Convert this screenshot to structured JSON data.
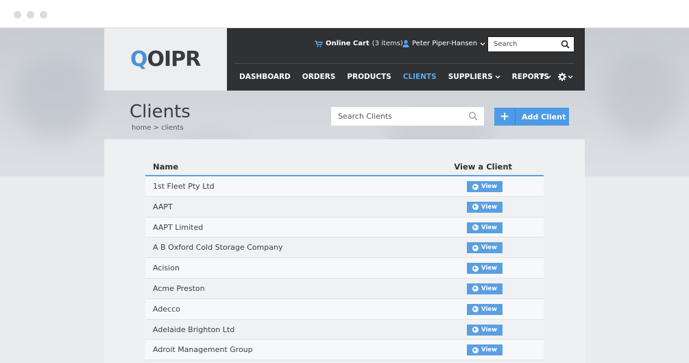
{
  "header": {
    "logo_text": "OIPR",
    "logo_q": "Q",
    "cart_label": "Online Cart",
    "cart_count": "(3 items)",
    "user_name": "Peter Piper-Hansen",
    "search_placeholder": "Search"
  },
  "nav": {
    "items": [
      {
        "label": "DASHBOARD"
      },
      {
        "label": "ORDERS"
      },
      {
        "label": "PRODUCTS"
      },
      {
        "label": "CLIENTS"
      },
      {
        "label": "SUPPLIERS"
      },
      {
        "label": "REPORTS"
      }
    ],
    "help_label": "?"
  },
  "page": {
    "title": "Clients",
    "breadcrumb": "home > clients",
    "search_placeholder": "Search Clients",
    "add_label": "Add Client"
  },
  "table": {
    "col_name": "Name",
    "col_view": "View a Client",
    "view_label": "View",
    "rows": [
      "1st Fleet Pty Ltd",
      "AAPT",
      "AAPT Limited",
      "A B Oxford Cold Storage Company",
      "Acision",
      "Acme Preston",
      "Adecco",
      "Adelaide Brighton Ltd",
      "Adroit Management Group"
    ]
  },
  "colors": {
    "accent": "#4d9be6",
    "topbar": "#2f3133",
    "active_nav": "#5aaaf0"
  },
  "icons": [
    "cart-icon",
    "user-icon",
    "search-icon",
    "chevron-down-icon",
    "gear-icon",
    "plus-icon",
    "arrow-circle-right-icon"
  ]
}
